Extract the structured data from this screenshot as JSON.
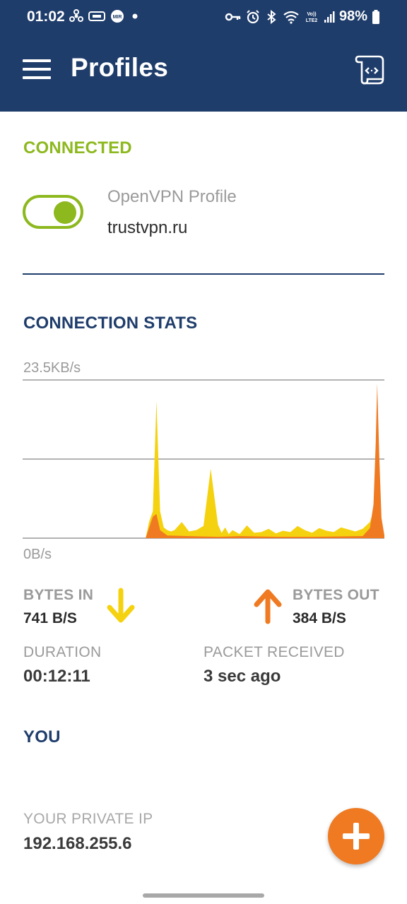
{
  "status_bar": {
    "time": "01:02",
    "battery": "98%",
    "left_icons": [
      "fan-icon",
      "card-icon",
      "mir-icon",
      "dot-icon"
    ],
    "right_icons": [
      "key-icon",
      "alarm-icon",
      "bluetooth-icon",
      "wifi-icon",
      "volte-icon",
      "signal-icon",
      "battery-icon"
    ]
  },
  "appbar": {
    "title": "Profiles"
  },
  "connection": {
    "status": "CONNECTED",
    "profile_type": "OpenVPN Profile",
    "profile_name": "trustvpn.ru",
    "toggle_on": true
  },
  "stats": {
    "heading": "CONNECTION STATS",
    "max_label": "23.5KB/s",
    "min_label": "0B/s",
    "bytes_in_label": "BYTES IN",
    "bytes_in_value": "741 B/S",
    "bytes_out_label": "BYTES OUT",
    "bytes_out_value": "384 B/S",
    "duration_label": "DURATION",
    "duration_value": "00:12:11",
    "packet_label": "PACKET RECEIVED",
    "packet_value": "3 sec ago"
  },
  "you": {
    "heading": "YOU",
    "ip_label": "YOUR PRIVATE IP",
    "ip_value": "192.168.255.6"
  },
  "colors": {
    "primary": "#1f3d6b",
    "connected": "#8db81e",
    "bytes_in": "#f5d20f",
    "bytes_out": "#ef7a22",
    "fab": "#ef7a22"
  },
  "chart_data": {
    "type": "area",
    "ylim": [
      0,
      23.5
    ],
    "y_unit": "KB/s",
    "series": [
      {
        "name": "BYTES IN",
        "color": "#f5d20f",
        "x": [
          0,
          34,
          35,
          36,
          37,
          38,
          39,
          40,
          41,
          42,
          44,
          46,
          48,
          50,
          52,
          54,
          55,
          56,
          57,
          58,
          60,
          62,
          64,
          66,
          68,
          70,
          72,
          74,
          76,
          78,
          80,
          82,
          84,
          86,
          88,
          90,
          92,
          94,
          96,
          97,
          98,
          99,
          100
        ],
        "values": [
          0,
          0,
          2.5,
          4,
          20.4,
          4,
          1.6,
          1.2,
          1.0,
          1.2,
          2.4,
          1.0,
          1.2,
          1.8,
          10.3,
          2,
          0.8,
          1.6,
          0.6,
          1.2,
          0.6,
          1.9,
          0.8,
          0.9,
          1.4,
          0.7,
          1.1,
          0.9,
          1.8,
          1.2,
          0.8,
          1.5,
          1.1,
          0.9,
          1.6,
          1.3,
          1.0,
          1.4,
          2.4,
          4.0,
          2.2,
          1.0,
          0.6
        ]
      },
      {
        "name": "BYTES OUT",
        "color": "#ef7a22",
        "x": [
          0,
          34,
          36,
          37,
          38,
          40,
          46,
          54,
          60,
          70,
          80,
          94,
          96,
          97,
          97.6,
          98,
          98.6,
          99.2,
          100
        ],
        "values": [
          0,
          0,
          3.2,
          3.6,
          1.2,
          0.4,
          0.3,
          0.2,
          0.3,
          0.2,
          0.2,
          0.3,
          1.5,
          5.0,
          14.0,
          23.0,
          12.0,
          3.0,
          0.4
        ]
      }
    ]
  }
}
